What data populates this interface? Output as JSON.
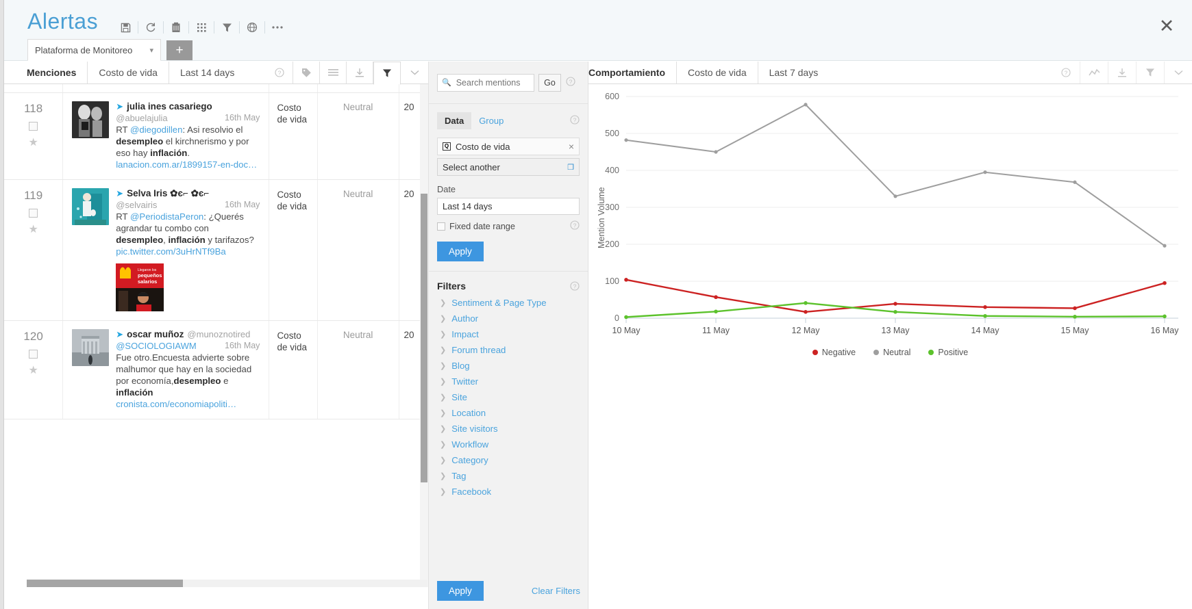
{
  "topbar": {
    "title": "Alertas",
    "icons": [
      "save-icon",
      "refresh-icon",
      "clipboard-icon",
      "grid-icon",
      "funnel-icon",
      "globe-icon",
      "more-icon"
    ],
    "close_label": "✕"
  },
  "tabs": {
    "selected": "Plataforma de Monitoreo",
    "add_label": "+"
  },
  "mentions": {
    "title": "Menciones",
    "crumbs": [
      "Costo de vida",
      "Last 14 days"
    ],
    "tool_icons": [
      "help-icon",
      "tag-icon",
      "list-icon",
      "download-icon",
      "funnel-icon",
      "chevron-down-icon"
    ],
    "rows": [
      {
        "index": "118",
        "name": "julia ines casariego",
        "handle": "@abuelajulia",
        "handle_inline": "",
        "date": "16th May",
        "text_prefix": "RT ",
        "mention": "@diegodillen",
        "text_mid": ": Asi resolvio el ",
        "bold1": "desempleo",
        "text_mid2": " el kirchnerismo y por eso hay ",
        "bold2": "inflación",
        "text_suffix": ".",
        "link": "lanacion.com.ar/1899157-en-doc…",
        "topic": "Costo de vida",
        "sentiment": "Neutral",
        "num": "20",
        "has_image": false,
        "avatar_kind": "bw-photo"
      },
      {
        "index": "119",
        "name": "Selva Iris ✿є⌐ ✿є⌐",
        "handle": "@selvairis",
        "handle_inline": "",
        "date": "16th May",
        "text_prefix": "RT ",
        "mention": "@PeriodistaPeron",
        "text_mid": ": ¿Querés agrandar tu combo con ",
        "bold1": "desempleo",
        "text_mid2": ", ",
        "bold2": "inflación",
        "text_suffix": " y tarifazos?",
        "link": "pic.twitter.com/3uHrNTf9Ba",
        "topic": "Costo de vida",
        "sentiment": "Neutral",
        "num": "20",
        "has_image": true,
        "image_caption_small": "Llegaron los",
        "image_caption_big": "pequeños salarios",
        "avatar_kind": "teal-illustration"
      },
      {
        "index": "120",
        "name": "oscar muñoz",
        "handle": "@SOCIOLOGIAWM",
        "handle_inline": "@munoznotired",
        "date": "16th May",
        "text_prefix": "Fue otro.Encuesta advierte sobre malhumor que hay en la sociedad por economía,",
        "mention": "",
        "text_mid": "",
        "bold1": "desempleo",
        "text_mid2": " e ",
        "bold2": "inflación",
        "text_suffix": "",
        "link": "cronista.com/economiapoliti…",
        "topic": "Costo de vida",
        "sentiment": "Neutral",
        "num": "20",
        "has_image": false,
        "avatar_kind": "gate-photo"
      }
    ]
  },
  "filter_panel": {
    "search": {
      "placeholder": "Search mentions",
      "value": "",
      "go_label": "Go"
    },
    "data_tabs": [
      {
        "label": "Data",
        "selected": true
      },
      {
        "label": "Group",
        "selected": false
      }
    ],
    "selected_data": "Costo de vida",
    "select_another": "Select another",
    "date_label": "Date",
    "date_value": "Last 14 days",
    "fixed_date_label": "Fixed date range",
    "fixed_date_checked": false,
    "apply_label": "Apply",
    "filters_title": "Filters",
    "filters": [
      "Sentiment & Page Type",
      "Author",
      "Impact",
      "Forum thread",
      "Blog",
      "Twitter",
      "Site",
      "Location",
      "Site visitors",
      "Workflow",
      "Category",
      "Tag",
      "Facebook"
    ],
    "footer_apply_label": "Apply",
    "clear_filters_label": "Clear Filters"
  },
  "chart_panel": {
    "title": "Comportamiento",
    "crumbs": [
      "Costo de vida",
      "Last 7 days"
    ],
    "tool_icons": [
      "help-icon",
      "line-chart-icon",
      "download-icon",
      "funnel-icon",
      "chevron-down-icon"
    ]
  },
  "chart_data": {
    "type": "line",
    "title": "Comportamiento",
    "xlabel": "",
    "ylabel": "Mention Volume",
    "categories": [
      "10 May",
      "11 May",
      "12 May",
      "13 May",
      "14 May",
      "15 May",
      "16 May"
    ],
    "ylim": [
      0,
      600
    ],
    "yticks": [
      0,
      100,
      200,
      300,
      400,
      500,
      600
    ],
    "grid": true,
    "legend_position": "bottom",
    "series": [
      {
        "name": "Negative",
        "color": "#cc2222",
        "values": [
          104,
          57,
          17,
          39,
          30,
          27,
          95
        ]
      },
      {
        "name": "Neutral",
        "color": "#9e9e9e",
        "values": [
          482,
          450,
          578,
          330,
          395,
          368,
          196
        ]
      },
      {
        "name": "Positive",
        "color": "#5cc22c",
        "values": [
          3,
          18,
          41,
          17,
          6,
          4,
          5
        ]
      }
    ]
  }
}
